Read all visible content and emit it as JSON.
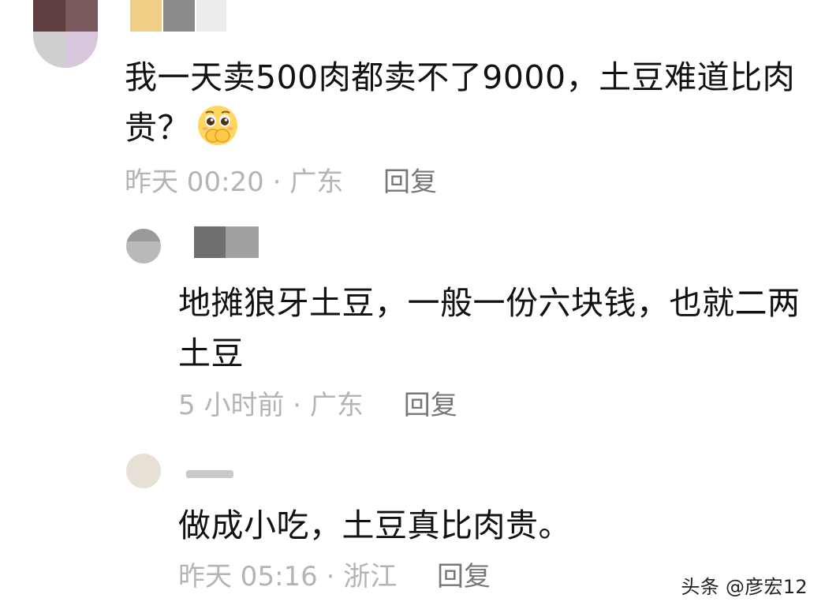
{
  "comments": [
    {
      "text_line1": "我一天卖500肉都卖不了9000，土豆难道比肉",
      "text_line2": "贵？",
      "emoji": "pleading-face-covering-mouth-icon",
      "time": "昨天 00:20",
      "sep": "·",
      "location": "广东",
      "reply_label": "回复"
    },
    {
      "text_line1": "地摊狼牙土豆，一般一份六块钱，也就二两",
      "text_line2": "土豆",
      "time": "5 小时前",
      "sep": "·",
      "location": "广东",
      "reply_label": "回复"
    },
    {
      "text_line1": "做成小吃，土豆真比肉贵。",
      "time": "昨天 05:16",
      "sep": "·",
      "location": "浙江",
      "reply_label": "回复"
    }
  ],
  "watermark": "头条 @彦宏12",
  "colors": {
    "text": "#111111",
    "meta": "#b4b4b4",
    "reply": "#777777",
    "name_blur_yellow": "#efcf86",
    "name_blur_gray": "#8a8a8a"
  }
}
